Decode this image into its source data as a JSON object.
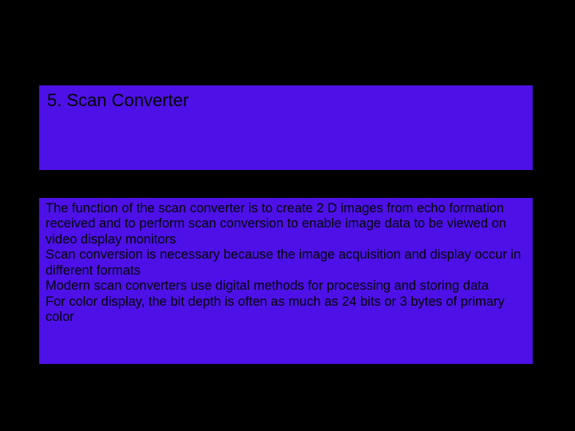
{
  "slide": {
    "title": "5. Scan Converter",
    "body": "The function of the scan converter is to create 2 D images from echo formation received and to perform scan conversion to enable image data to be viewed on video display monitors\nScan conversion is necessary because the image acquisition and display occur in different formats\nModern scan converters use digital methods for processing and storing data\nFor color display, the bit depth is often as much as 24 bits or 3 bytes of primary color"
  }
}
